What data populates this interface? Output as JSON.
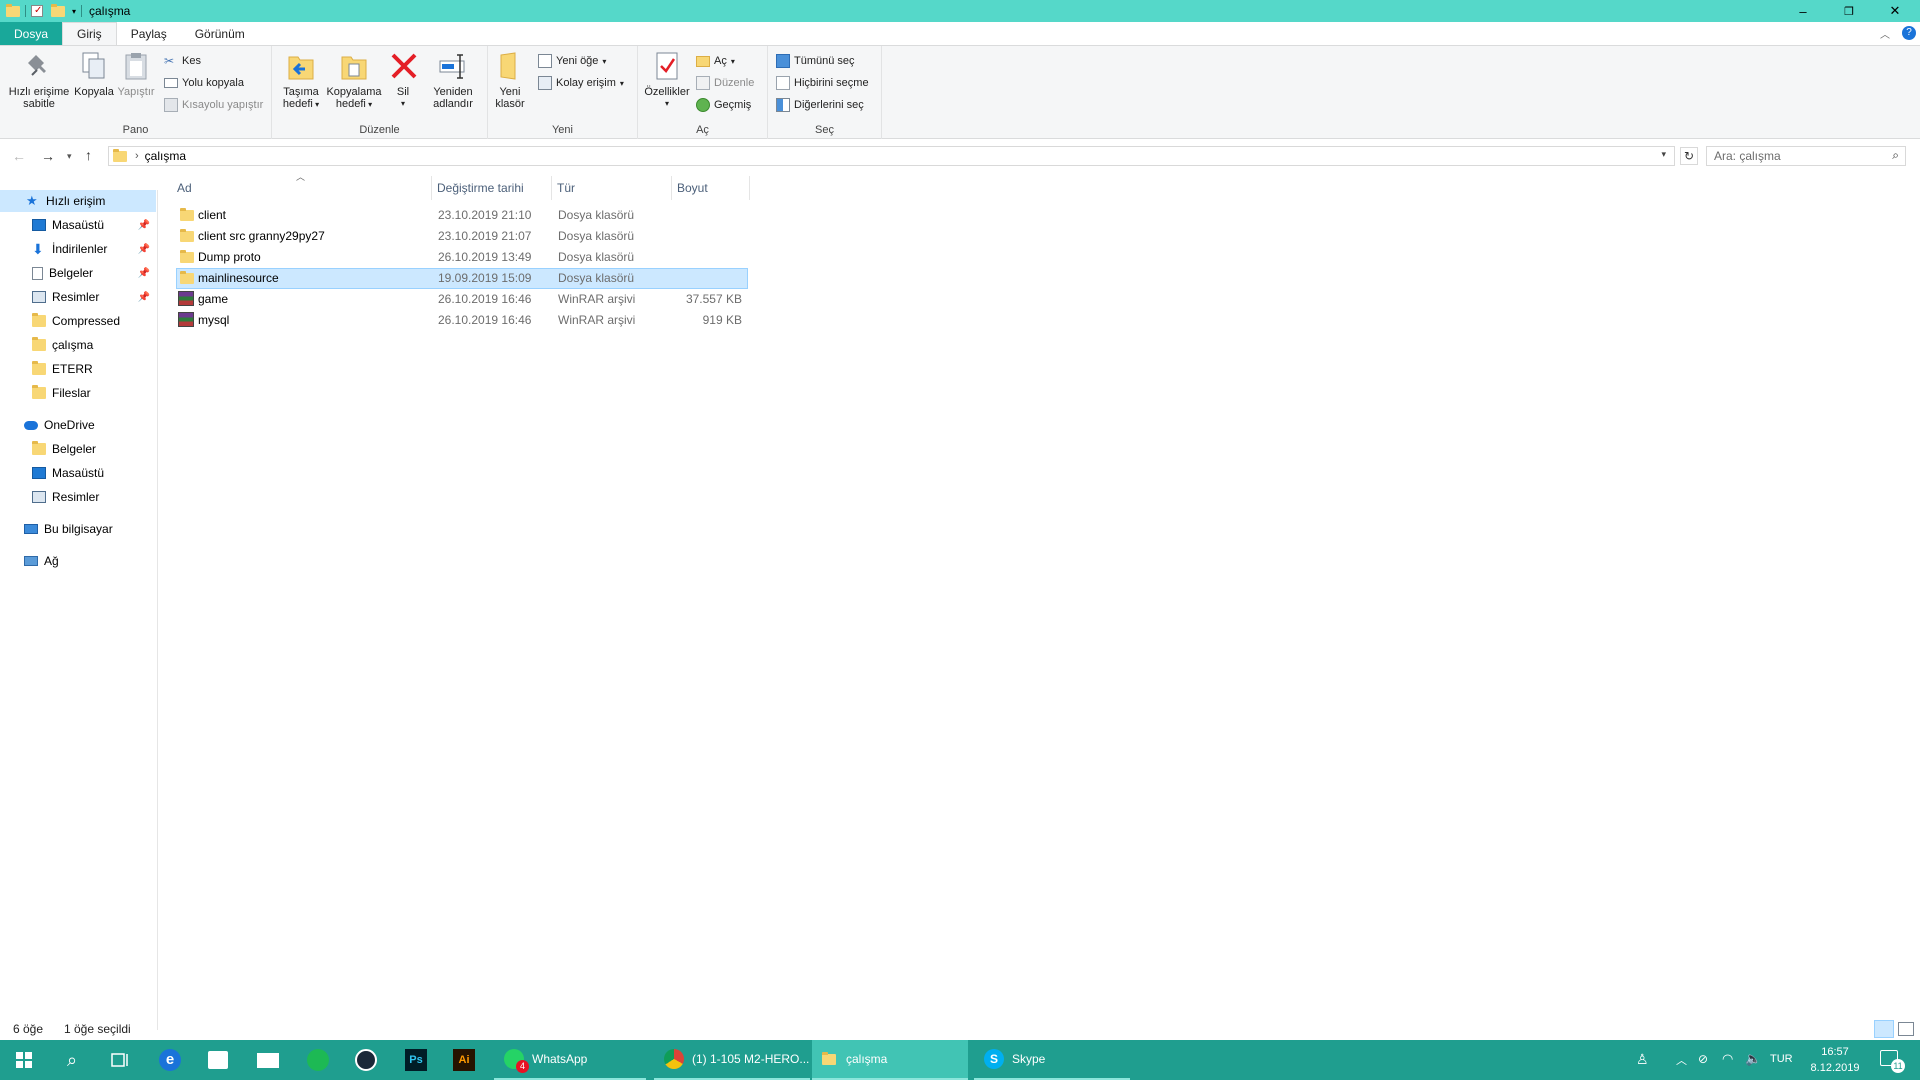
{
  "window": {
    "title": "çalışma",
    "controls": {
      "minimize": "–",
      "restore": "❐",
      "close": "✕"
    }
  },
  "ribbon_tabs": [
    "Dosya",
    "Giriş",
    "Paylaş",
    "Görünüm"
  ],
  "ribbon": {
    "pano": {
      "label": "Pano",
      "pin": "Hızlı erişime sabitle",
      "pin_line1": "Hızlı erişime",
      "pin_line2": "sabitle",
      "copy": "Kopyala",
      "paste": "Yapıştır",
      "cut": "Kes",
      "copy_path": "Yolu kopyala",
      "paste_shortcut": "Kısayolu yapıştır"
    },
    "duzenle": {
      "label": "Düzenle",
      "move_l1": "Taşıma",
      "move_l2": "hedefi",
      "copyto_l1": "Kopyalama",
      "copyto_l2": "hedefi",
      "delete": "Sil",
      "rename_l1": "Yeniden",
      "rename_l2": "adlandır"
    },
    "yeni": {
      "label": "Yeni",
      "newfolder_l1": "Yeni",
      "newfolder_l2": "klasör",
      "new_item": "Yeni öğe",
      "easy_access": "Kolay erişim"
    },
    "ac": {
      "label": "Aç",
      "properties": "Özellikler",
      "open": "Aç",
      "edit": "Düzenle",
      "history": "Geçmiş"
    },
    "sec": {
      "label": "Seç",
      "select_all": "Tümünü seç",
      "select_none": "Hiçbirini seçme",
      "invert": "Diğerlerini seç"
    }
  },
  "address": {
    "path": "çalışma",
    "search_placeholder": "Ara: çalışma"
  },
  "nav": {
    "quick_access": "Hızlı erişim",
    "quick_items": [
      "Masaüstü",
      "İndirilenler",
      "Belgeler",
      "Resimler",
      "Compressed",
      "çalışma",
      "ETERR",
      "Fileslar"
    ],
    "onedrive": "OneDrive",
    "onedrive_items": [
      "Belgeler",
      "Masaüstü",
      "Resimler"
    ],
    "this_pc": "Bu bilgisayar",
    "network": "Ağ"
  },
  "columns": {
    "name": "Ad",
    "date": "Değiştirme tarihi",
    "type": "Tür",
    "size": "Boyut"
  },
  "files": [
    {
      "name": "client",
      "date": "23.10.2019 21:10",
      "type": "Dosya klasörü",
      "size": "",
      "kind": "folder"
    },
    {
      "name": "client src granny29py27",
      "date": "23.10.2019 21:07",
      "type": "Dosya klasörü",
      "size": "",
      "kind": "folder"
    },
    {
      "name": "Dump proto",
      "date": "26.10.2019 13:49",
      "type": "Dosya klasörü",
      "size": "",
      "kind": "folder"
    },
    {
      "name": "mainlinesource",
      "date": "19.09.2019 15:09",
      "type": "Dosya klasörü",
      "size": "",
      "kind": "folder",
      "selected": true
    },
    {
      "name": "game",
      "date": "26.10.2019 16:46",
      "type": "WinRAR arşivi",
      "size": "37.557 KB",
      "kind": "rar"
    },
    {
      "name": "mysql",
      "date": "26.10.2019 16:46",
      "type": "WinRAR arşivi",
      "size": "919 KB",
      "kind": "rar"
    }
  ],
  "status": {
    "count": "6 öğe",
    "selected": "1 öğe seçildi"
  },
  "taskbar": {
    "apps": [
      {
        "label": "WhatsApp",
        "badge": "4"
      },
      {
        "label": "(1) 1-105 M2-HERO..."
      },
      {
        "label": "çalışma"
      },
      {
        "label": "Skype"
      }
    ],
    "lang": "TUR",
    "time": "16:57",
    "date": "8.12.2019",
    "notif_count": "11"
  },
  "colors": {
    "titlebar": "#55d8c9",
    "taskbar": "#1f9e8f",
    "selection": "#cce8ff",
    "file_tab": "#19a89a"
  }
}
